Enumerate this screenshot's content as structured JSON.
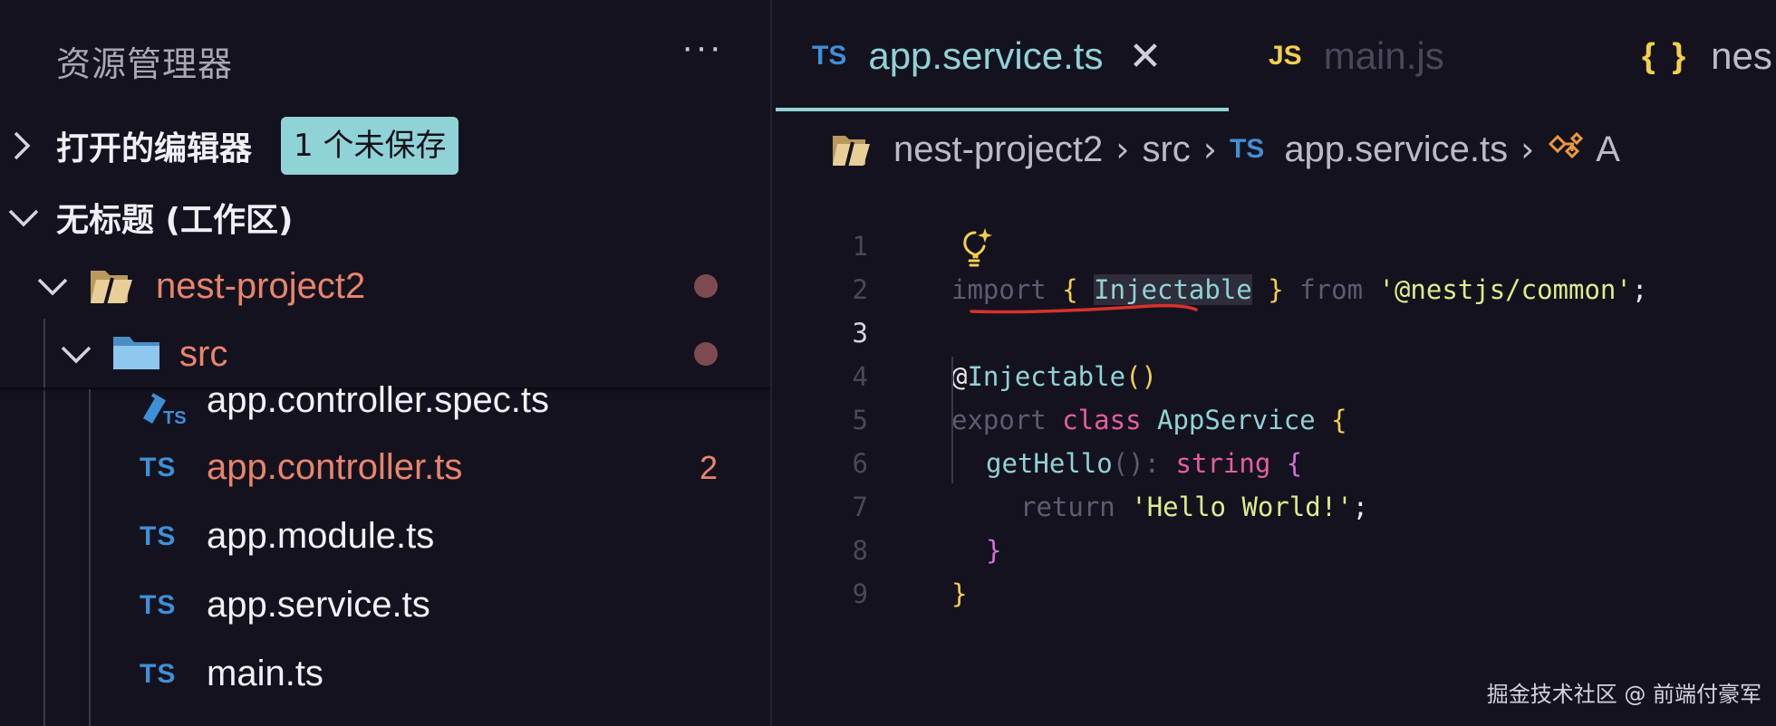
{
  "sidebar": {
    "title": "资源管理器",
    "more_label": "···",
    "open_editors": {
      "label": "打开的编辑器",
      "badge": "1 个未保存"
    },
    "workspace": {
      "label": "无标题 (工作区)"
    },
    "project": {
      "name": "nest-project2"
    },
    "src_folder": {
      "name": "src"
    },
    "files": [
      {
        "icon": "TS",
        "name": "app.controller.spec.ts",
        "error_count": ""
      },
      {
        "icon": "TS",
        "name": "app.controller.ts",
        "error_count": "2"
      },
      {
        "icon": "TS",
        "name": "app.module.ts",
        "error_count": ""
      },
      {
        "icon": "TS",
        "name": "app.service.ts",
        "error_count": ""
      },
      {
        "icon": "TS",
        "name": "main.ts",
        "error_count": ""
      }
    ]
  },
  "tabs": [
    {
      "icon": "TS",
      "label": "app.service.ts",
      "active": true,
      "close": "✕"
    },
    {
      "icon": "JS",
      "label": "main.js",
      "active": false
    },
    {
      "icon": "{ }",
      "label": "nes",
      "active": false
    }
  ],
  "breadcrumb": {
    "folder": "nest-project2",
    "sub": "src",
    "file_icon": "TS",
    "file": "app.service.ts",
    "symbol": "A"
  },
  "code": {
    "line_numbers": [
      "1",
      "2",
      "3",
      "4",
      "5",
      "6",
      "7",
      "8",
      "9"
    ],
    "current_line": "3",
    "import_kw": "import",
    "lbrace": "{",
    "injectable": "Injectable",
    "rbrace": "}",
    "from_kw": "from",
    "module_str": "'@nestjs/common'",
    "semi": ";",
    "decorator_at": "@",
    "decorator_name": "Injectable",
    "decorator_parens": "()",
    "export_kw": "export",
    "class_kw": "class",
    "class_name": "AppService",
    "method_name": "getHello",
    "method_parens": "()",
    "colon": ":",
    "return_type": "string",
    "return_kw": "return",
    "hello_str": "'Hello World!'"
  },
  "watermark": "掘金技术社区 @ 前端付豪军",
  "colors": {
    "background": "#15121f",
    "accent_cyan": "#8fd3d6",
    "ts_blue": "#3f8fd6",
    "js_yellow": "#f2d04b",
    "error_orange": "#e8846c",
    "string_green": "#d9ef8a",
    "keyword_pink": "#e45f9f",
    "annotation_red": "#d8322b"
  }
}
